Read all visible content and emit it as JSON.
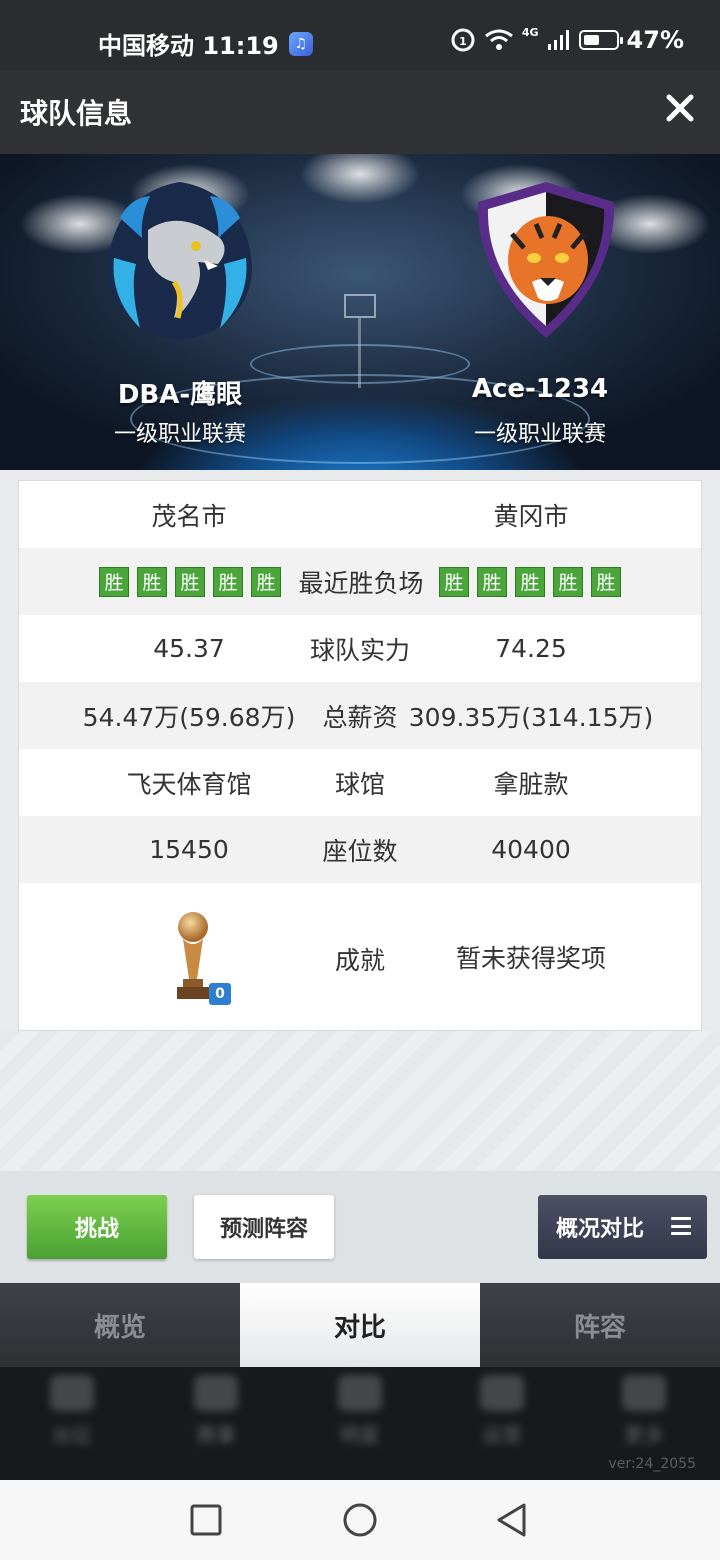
{
  "status_bar": {
    "carrier_time": "中国移动 11:19",
    "network": "4G",
    "battery": "47%",
    "battery_level": 0.47
  },
  "header": {
    "title": "球队信息"
  },
  "teams": {
    "home": {
      "name": "DBA-鹰眼",
      "league": "一级职业联赛",
      "logo": "dragon-logo-icon"
    },
    "away": {
      "name": "Ace-1234",
      "league": "一级职业联赛",
      "logo": "tiger-logo-icon"
    }
  },
  "comparison": {
    "city": {
      "left": "茂名市",
      "label": "",
      "right": "黄冈市"
    },
    "recent": {
      "label": "最近胜负场",
      "left": [
        "胜",
        "胜",
        "胜",
        "胜",
        "胜"
      ],
      "right": [
        "胜",
        "胜",
        "胜",
        "胜",
        "胜"
      ]
    },
    "strength": {
      "left": "45.37",
      "label": "球队实力",
      "right": "74.25"
    },
    "salary": {
      "left": "54.47万(59.68万)",
      "label": "总薪资",
      "right": "309.35万(314.15万)"
    },
    "arena": {
      "left": "飞天体育馆",
      "label": "球馆",
      "right": "拿脏款"
    },
    "seats": {
      "left": "15450",
      "label": "座位数",
      "right": "40400"
    },
    "achievement": {
      "trophy_count": "0",
      "label": "成就",
      "right": "暂未获得奖项"
    }
  },
  "actions": {
    "challenge": "挑战",
    "predict": "预测阵容",
    "compare": "概况对比"
  },
  "tabs": [
    {
      "label": "概览",
      "active": false
    },
    {
      "label": "对比",
      "active": true
    },
    {
      "label": "阵容",
      "active": false
    }
  ],
  "bottom_nav": {
    "items": [
      "出征",
      "赛事",
      "明星",
      "运营",
      "更多"
    ],
    "version": "ver:24_2055"
  },
  "colors": {
    "win_badge": "#4aa63a",
    "challenge_green": "#5fb83e",
    "compare_dark": "#3e4054"
  }
}
